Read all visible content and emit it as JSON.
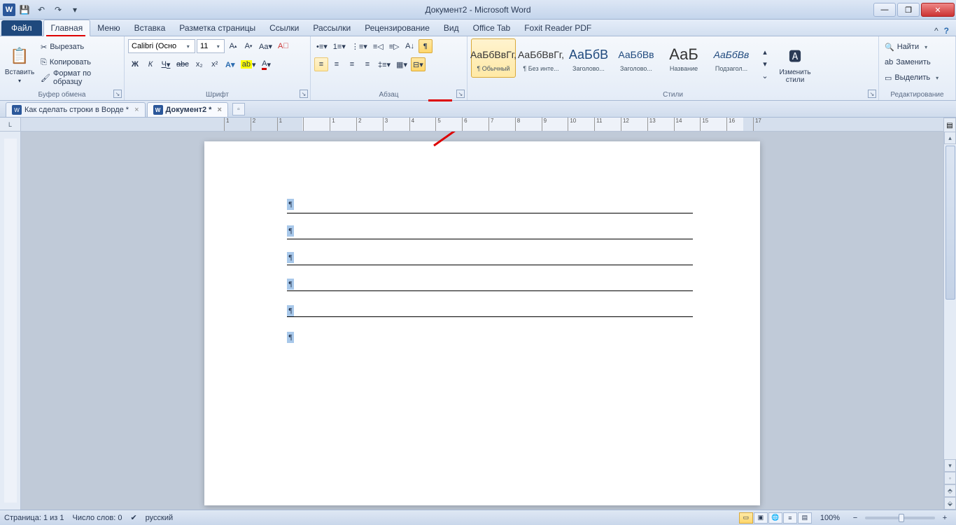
{
  "title": "Документ2 - Microsoft Word",
  "tabs": {
    "file": "Файл",
    "items": [
      "Главная",
      "Меню",
      "Вставка",
      "Разметка страницы",
      "Ссылки",
      "Рассылки",
      "Рецензирование",
      "Вид",
      "Office Tab",
      "Foxit Reader PDF"
    ],
    "active": "Главная"
  },
  "clipboard": {
    "paste": "Вставить",
    "cut": "Вырезать",
    "copy": "Копировать",
    "format_painter": "Формат по образцу",
    "label": "Буфер обмена"
  },
  "font": {
    "name": "Calibri (Осно",
    "size": "11",
    "label": "Шрифт",
    "bold": "Ж",
    "italic": "К",
    "underline": "Ч",
    "strike": "abc",
    "sub": "x₂",
    "sup": "x²"
  },
  "paragraph": {
    "label": "Абзац"
  },
  "styles": {
    "label": "Стили",
    "change": "Изменить стили",
    "items": [
      {
        "preview": "АаБбВвГг,",
        "name": "¶ Обычный",
        "active": true
      },
      {
        "preview": "АаБбВвГг,",
        "name": "¶ Без инте..."
      },
      {
        "preview": "АаБбВ",
        "name": "Заголово...",
        "big": true,
        "color": "#1f497d"
      },
      {
        "preview": "АаБбВв",
        "name": "Заголово...",
        "color": "#1f497d"
      },
      {
        "preview": "АаБ",
        "name": "Название",
        "big": true
      },
      {
        "preview": "АаБбВв",
        "name": "Подзагол...",
        "color": "#1f497d",
        "italic": true
      }
    ]
  },
  "editing": {
    "label": "Редактирование",
    "find": "Найти",
    "replace": "Заменить",
    "select": "Выделить"
  },
  "doctabs": [
    {
      "label": "Как сделать строки в Ворде *"
    },
    {
      "label": "Документ2 *",
      "active": true
    }
  ],
  "status": {
    "page": "Страница: 1 из 1",
    "words": "Число слов: 0",
    "lang": "русский",
    "zoom": "100%"
  },
  "ruler_marks": [
    "1",
    "2",
    "1",
    "",
    "1",
    "2",
    "3",
    "4",
    "5",
    "6",
    "7",
    "8",
    "9",
    "10",
    "11",
    "12",
    "13",
    "14",
    "15",
    "16",
    "17"
  ]
}
